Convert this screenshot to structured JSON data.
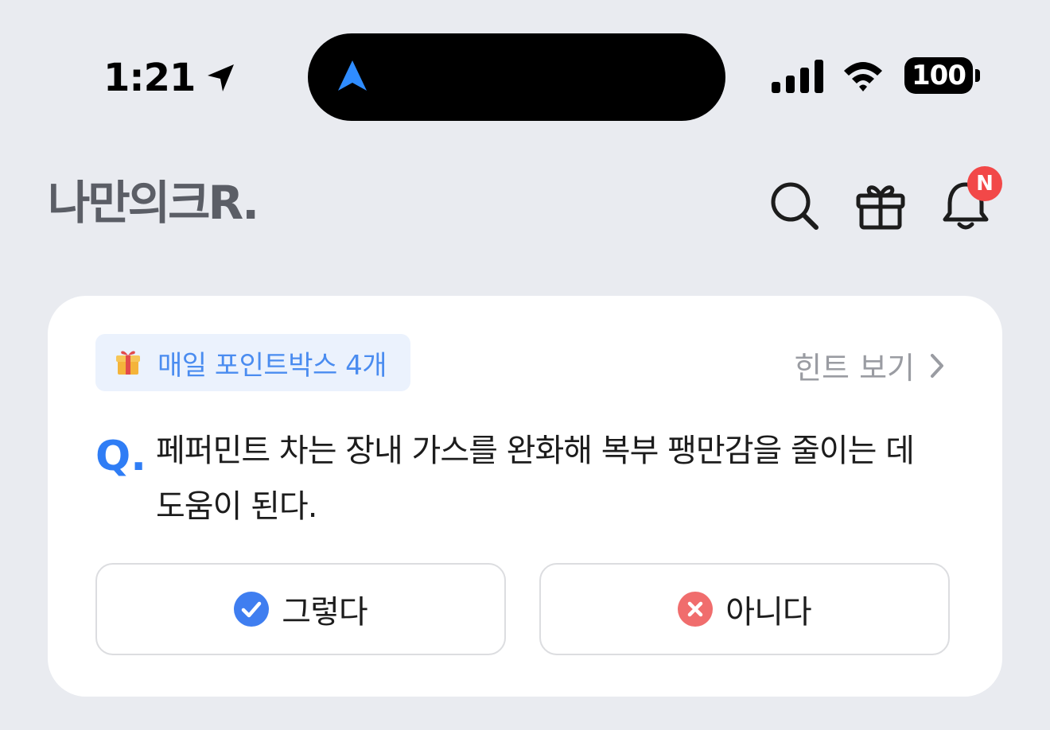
{
  "status_bar": {
    "time": "1:21",
    "battery": "100"
  },
  "header": {
    "logo": "나만의크R.",
    "notification_badge": "N",
    "icons": [
      "search-icon",
      "gift-icon",
      "bell-icon"
    ]
  },
  "quiz": {
    "points_chip": "매일 포인트박스 4개",
    "hint_label": "힌트 보기",
    "q_mark": "Q.",
    "question": "페퍼민트 차는 장내 가스를 완화해 복부 팽만감을 줄이는 데 도움이 된다.",
    "answers": [
      {
        "label": "그렇다",
        "icon": "check-circle-icon",
        "color": "#3f7ef0"
      },
      {
        "label": "아니다",
        "icon": "x-circle-icon",
        "color": "#f06d6d"
      }
    ]
  },
  "colors": {
    "background": "#e9ebf0",
    "accent": "#2f7df5",
    "badge": "#f24848",
    "chip_bg": "#ebf2fd"
  }
}
